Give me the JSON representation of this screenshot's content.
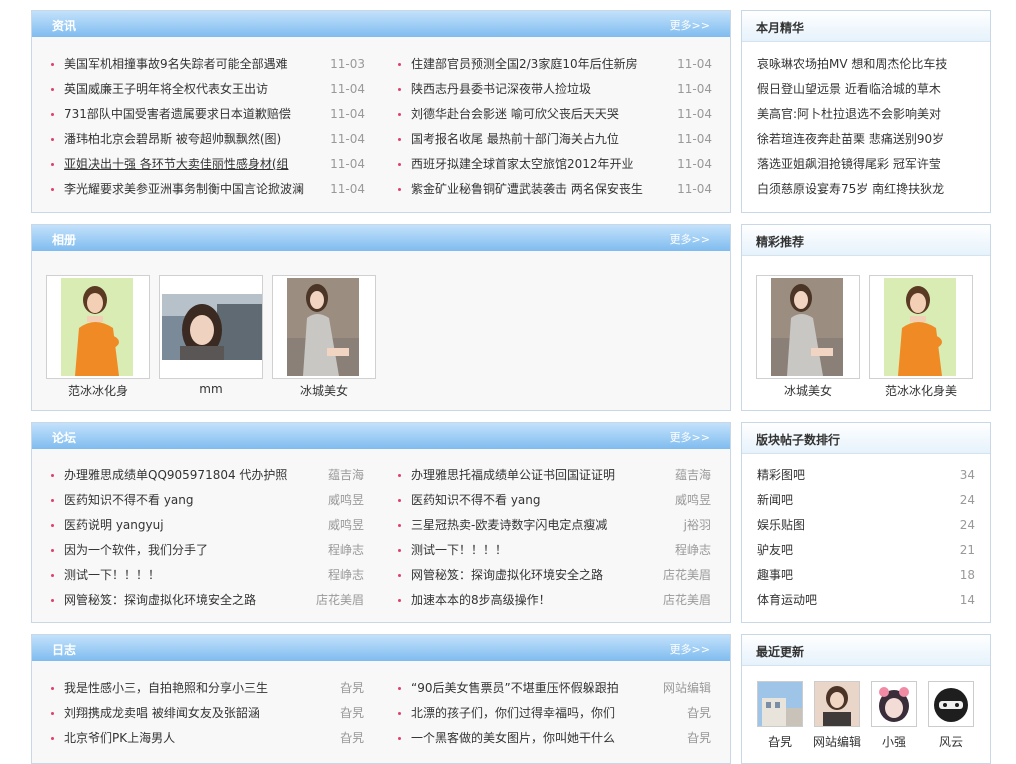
{
  "more_label": "更多>>",
  "news": {
    "title": "资讯",
    "left": [
      {
        "text": "美国军机相撞事故9名失踪者可能全部遇难",
        "date": "11-03"
      },
      {
        "text": "英国威廉王子明年将全权代表女王出访",
        "date": "11-04"
      },
      {
        "text": "731部队中国受害者遗属要求日本道歉赔偿",
        "date": "11-04"
      },
      {
        "text": "潘玮柏北京会碧昂斯 被夸超帅飘飘然(图)",
        "date": "11-04"
      },
      {
        "text": "亚姐决出十强 各环节大卖佳丽性感身材(组",
        "date": "11-04"
      },
      {
        "text": "李光耀要求美参亚洲事务制衡中国言论掀波澜",
        "date": "11-04"
      }
    ],
    "right": [
      {
        "text": "住建部官员预测全国2/3家庭10年后住新房",
        "date": "11-04"
      },
      {
        "text": "陕西志丹县委书记深夜带人捡垃圾",
        "date": "11-04"
      },
      {
        "text": "刘德华赴台会影迷 喻可欣父丧后天天哭",
        "date": "11-04"
      },
      {
        "text": "国考报名收尾 最热前十部门海关占九位",
        "date": "11-04"
      },
      {
        "text": "西班牙拟建全球首家太空旅馆2012年开业",
        "date": "11-04"
      },
      {
        "text": "紫金矿业秘鲁铜矿遭武装袭击 两名保安丧生",
        "date": "11-04"
      }
    ]
  },
  "album": {
    "title": "相册",
    "items": [
      {
        "caption": "范冰冰化身"
      },
      {
        "caption": "mm"
      },
      {
        "caption": "冰城美女"
      }
    ]
  },
  "forum": {
    "title": "论坛",
    "left": [
      {
        "text": "办理雅思成绩单QQ905971804 代办护照",
        "author": "蕴吉海"
      },
      {
        "text": "医药知识不得不看 yang",
        "author": "威鸣昱"
      },
      {
        "text": "医药说明 yangyuj",
        "author": "威鸣昱"
      },
      {
        "text": "因为一个软件，我们分手了",
        "author": "程峥志"
      },
      {
        "text": "测试一下！！！！",
        "author": "程峥志"
      },
      {
        "text": "网管秘笈：探询虚拟化环境安全之路",
        "author": "店花美眉"
      }
    ],
    "right": [
      {
        "text": "办理雅思托福成绩单公证书回国证证明",
        "author": "蕴吉海"
      },
      {
        "text": "医药知识不得不看 yang",
        "author": "威鸣昱"
      },
      {
        "text": "三星冠热卖-欧麦诗数字闪电定点瘦减",
        "author": "j裕羽"
      },
      {
        "text": "测试一下！！！！",
        "author": "程峥志"
      },
      {
        "text": "网管秘笈：探询虚拟化环境安全之路",
        "author": "店花美眉"
      },
      {
        "text": "加速本本的8步高级操作！",
        "author": "店花美眉"
      }
    ]
  },
  "blog": {
    "title": "日志",
    "left": [
      {
        "text": "我是性感小三，自拍艳照和分享小三生",
        "author": "旮旯"
      },
      {
        "text": "刘翔携成龙卖唱 被绯闻女友及张韶涵",
        "author": "旮旯"
      },
      {
        "text": "北京爷们PK上海男人",
        "author": "旮旯"
      }
    ],
    "right": [
      {
        "text": "“90后美女售票员”不堪重压怀假躲跟拍",
        "author": "网站编辑"
      },
      {
        "text": "北漂的孩子们，你们过得幸福吗，你们",
        "author": "旮旯"
      },
      {
        "text": "一个黑客做的美女图片，你叫她干什么",
        "author": "旮旯"
      }
    ]
  },
  "monthly": {
    "title": "本月精华",
    "items": [
      "哀咏琳农场拍MV 想和周杰伦比车技",
      "假日登山望远景 近看临洽城的草木",
      "美高官:阿卜杜拉退选不会影响美对",
      "徐若瑄连夜奔赴苗栗 悲痛送别90岁",
      "落选亚姐飙泪抢镜得尾彩 冠军许莹",
      "白须慈原设宴寿75岁 南红搀扶狄龙"
    ]
  },
  "recommend": {
    "title": "精彩推荐",
    "items": [
      {
        "caption": "冰城美女"
      },
      {
        "caption": "范冰冰化身美"
      }
    ]
  },
  "ranking": {
    "title": "版块帖子数排行",
    "items": [
      {
        "name": "精彩图吧",
        "count": "34"
      },
      {
        "name": "新闻吧",
        "count": "24"
      },
      {
        "name": "娱乐贴图",
        "count": "24"
      },
      {
        "name": "驴友吧",
        "count": "21"
      },
      {
        "name": "趣事吧",
        "count": "18"
      },
      {
        "name": "体育运动吧",
        "count": "14"
      }
    ]
  },
  "updates": {
    "title": "最近更新",
    "users": [
      "旮旯",
      "网站编辑",
      "小强",
      "风云"
    ]
  }
}
